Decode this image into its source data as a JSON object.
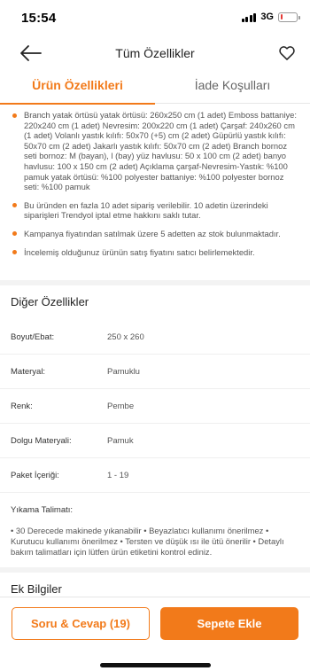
{
  "status_bar": {
    "time": "15:54",
    "network": "3G",
    "battery_level": 0.15,
    "battery_color": "#e53935"
  },
  "nav": {
    "title": "Tüm Özellikler",
    "back_icon": "arrow-left-icon",
    "favorite_icon": "heart-icon"
  },
  "tabs": [
    {
      "label": "Ürün Özellikleri",
      "active": true
    },
    {
      "label": "İade Koşulları",
      "active": false
    }
  ],
  "bullets": [
    "Branch yatak örtüsü yatak örtüsü: 260x250 cm (1 adet) Emboss battaniye: 220x240 cm (1 adet) Nevresim: 200x220 cm (1 adet) Çarşaf: 240x260 cm (1 adet) Volanlı yastık kılıfı: 50x70 (+5) cm (2 adet) Güpürlü yastık kılıfı: 50x70 cm (2 adet) Jakarlı yastık kılıfı: 50x70 cm (2 adet) Branch bornoz seti bornoz: M (bayan), l (bay) yüz havlusu: 50 x 100 cm (2 adet) banyo havlusu: 100 x 150 cm (2 adet) Açıklama çarşaf-Nevresim-Yastık: %100 pamuk yatak örtüsü: %100 polyester battaniye: %100 polyester bornoz seti: %100 pamuk",
    "Bu üründen en fazla 10 adet sipariş verilebilir. 10 adetin üzerindeki siparişleri Trendyol iptal etme hakkını saklı tutar.",
    "Kampanya fiyatından satılmak üzere 5 adetten az stok bulunmaktadır.",
    "İncelemiş olduğunuz ürünün satış fiyatını satıcı belirlemektedir."
  ],
  "other_features": {
    "title": "Diğer Özellikler",
    "rows": [
      {
        "label": "Boyut/Ebat:",
        "value": "250 x 260"
      },
      {
        "label": "Materyal:",
        "value": "Pamuklu"
      },
      {
        "label": "Renk:",
        "value": "Pembe"
      },
      {
        "label": "Dolgu Materyali:",
        "value": "Pamuk"
      },
      {
        "label": "Paket İçeriği:",
        "value": "1 - 19"
      }
    ],
    "washing_label": "Yıkama Talimatı:",
    "washing_text": "• 30 Derecede makinede yıkanabilir • Beyazlatıcı kullanımı önerilmez • Kurutucu kullanımı önerilmez • Tersten ve düşük ısı ile ütü önerilir • Detaylı bakım talimatları için lütfen ürün etiketini kontrol ediniz."
  },
  "extra_info": {
    "title": "Ek Bilgiler"
  },
  "actions": {
    "qa_label": "Soru & Cevap (19)",
    "cart_label": "Sepete Ekle"
  },
  "colors": {
    "accent": "#f27a1a"
  }
}
